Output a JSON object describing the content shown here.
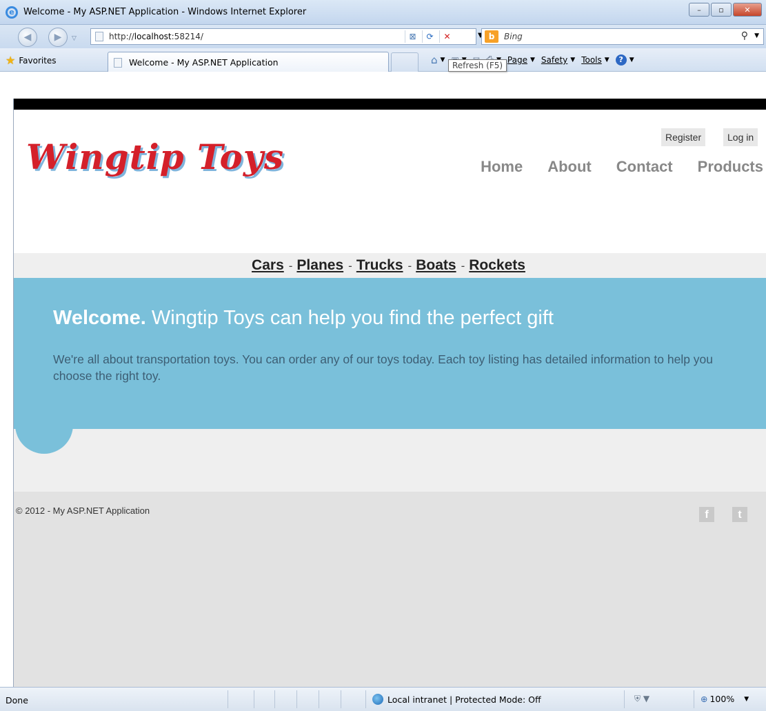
{
  "window": {
    "title": "Welcome - My ASP.NET Application - Windows Internet Explorer",
    "minimize": "–",
    "maximize": "▫",
    "close": "✕"
  },
  "address": {
    "url_prefix": "http://",
    "url_host": "localhost",
    "url_rest": ":58214/",
    "search_placeholder": "Bing",
    "search_provider_icon": "b"
  },
  "favbar": {
    "favorites_label": "Favorites",
    "tab_title": "Welcome - My ASP.NET Application",
    "commands": {
      "page": "Page",
      "safety": "Safety",
      "tools": "Tools"
    }
  },
  "tooltip": "Refresh (F5)",
  "site": {
    "logo": "Wingtip Toys",
    "account": {
      "register": "Register",
      "login": "Log in"
    },
    "nav": [
      "Home",
      "About",
      "Contact",
      "Products"
    ],
    "categories": [
      "Cars",
      "Planes",
      "Trucks",
      "Boats",
      "Rockets"
    ],
    "category_separator": "-",
    "hero": {
      "title_bold": "Welcome.",
      "title_rest": "Wingtip Toys can help you find the perfect gift",
      "body": "We're all about transportation toys. You can order any of our toys today. Each toy listing has detailed information to help you choose the right toy."
    },
    "footer": {
      "copyright": "© 2012 - My ASP.NET Application",
      "facebook_glyph": "f",
      "twitter_glyph": "t"
    }
  },
  "status": {
    "text": "Done",
    "zone": "Local intranet | Protected Mode: Off",
    "zoom": "100%"
  },
  "colors": {
    "logo_red": "#d4202a",
    "hero_blue": "#7ac0da",
    "nav_gray": "#888888",
    "footer_bg": "#e2e2e2"
  }
}
